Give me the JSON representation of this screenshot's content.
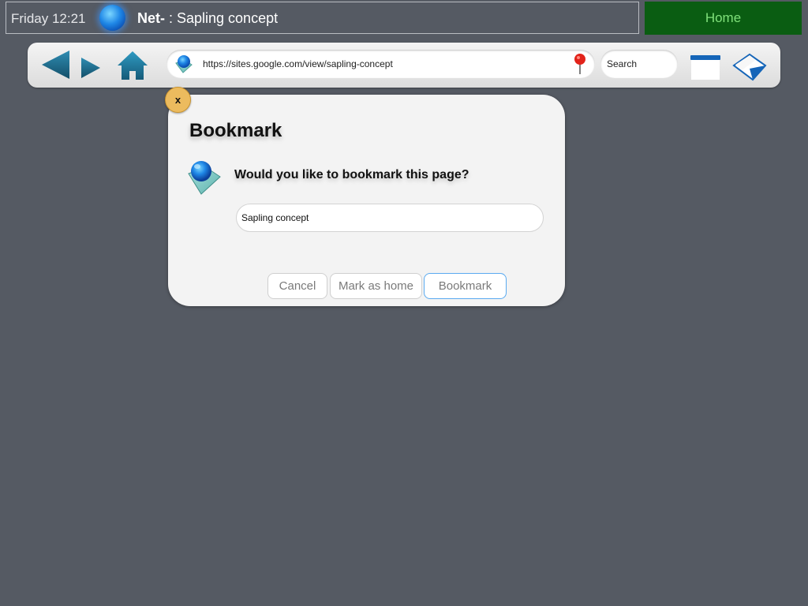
{
  "statusbar": {
    "time": "Friday 12:21",
    "app_brand": "Net-",
    "page_title": " : Sapling concept",
    "home_label": "Home"
  },
  "toolbar": {
    "url": "https://sites.google.com/view/sapling-concept",
    "search_label": "Search",
    "icons": [
      "back-arrow-icon",
      "forward-arrow-icon",
      "home-icon",
      "globe-icon",
      "pin-icon",
      "tabs-icon",
      "bookmarks-book-icon"
    ]
  },
  "dialog": {
    "close_label": "x",
    "title": "Bookmark",
    "question": "Would you like to bookmark this page?",
    "name_value": "Sapling concept",
    "buttons": {
      "cancel": "Cancel",
      "mark_home": "Mark as home",
      "bookmark": "Bookmark"
    }
  },
  "colors": {
    "background": "#555a63",
    "home_button": "#0a5d12",
    "home_text": "#7fe07a",
    "accent_blue": "#1f87e6",
    "nav_teal": "#1d6f8e",
    "close_button": "#ecbb5e",
    "focus_border": "#5aaaf0"
  }
}
